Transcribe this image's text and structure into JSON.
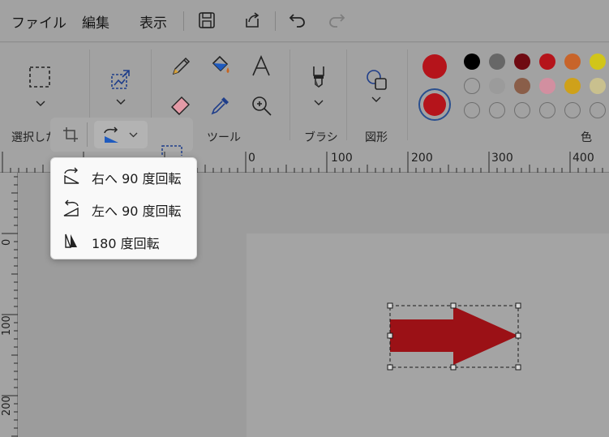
{
  "menu": {
    "file": "ファイル",
    "edit": "編集",
    "view": "表示"
  },
  "ribbon": {
    "groups": {
      "selection": "選択した",
      "tools": "ツール",
      "brush": "ブラシ",
      "shapes": "図形",
      "colors": "色"
    },
    "colors": {
      "primary": "#b5141b",
      "secondary": "#b5141b",
      "palette_row1": [
        "#000000",
        "#676767",
        "#6f0a12",
        "#b5141b",
        "#c8642a",
        "#d1c51a"
      ],
      "palette_row2": [
        "",
        "#9b9b9b",
        "#8a5e49",
        "#d28fa0",
        "#cfa11a",
        "#c9c08e"
      ]
    }
  },
  "ruler": {
    "h_labels": [
      "0",
      "100",
      "200",
      "300",
      "400"
    ],
    "v_labels": [
      "0",
      "100",
      "200"
    ]
  },
  "rotate_menu": {
    "items": [
      {
        "label": "右へ 90 度回転",
        "icon": "rotate-right-icon"
      },
      {
        "label": "左へ 90 度回転",
        "icon": "rotate-left-icon"
      },
      {
        "label": "180 度回転",
        "icon": "rotate-180-icon"
      }
    ]
  },
  "canvas": {
    "shape": "arrow-right",
    "shape_color": "#9b1116"
  }
}
